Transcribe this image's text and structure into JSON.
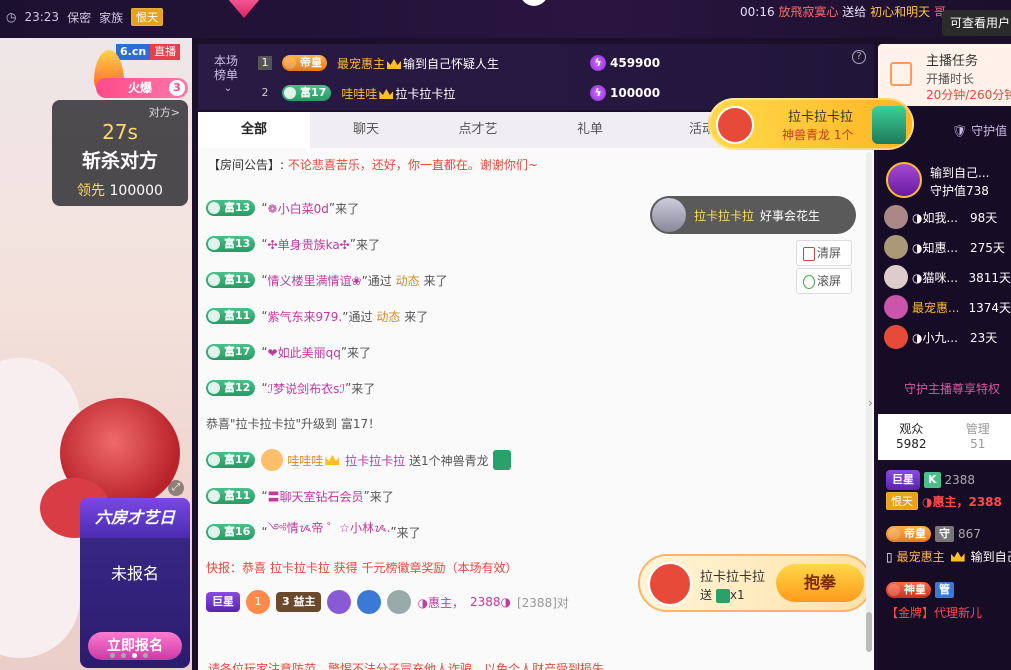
{
  "topbar": {
    "time": "23:23",
    "secret": "保密",
    "family": "家族",
    "family_badge": "恨天",
    "timer": "00:16",
    "ticker_a": "放飛寂寞心",
    "ticker_b": "送给",
    "ticker_c": "初心和明天",
    "ticker_d": "哥",
    "tooltip": "可查看用户"
  },
  "video": {
    "site_tag": "6.cn",
    "live_tag": "直播",
    "fire_label": "火爆",
    "fire_level": "3",
    "pk": {
      "link": "对方>",
      "timer": "27s",
      "title": "斩杀对方",
      "lead_label": "领先",
      "lead_value": "100000"
    },
    "sixroom": {
      "title": "六房才艺日",
      "status": "未报名",
      "button": "立即报名"
    }
  },
  "rank": {
    "label": "本场榜单",
    "rows": [
      {
        "no": "1",
        "level": "帝皇",
        "name": "最宠惠主",
        "target": "输到自己怀疑人生",
        "value": "459900"
      },
      {
        "no": "2",
        "level": "富17",
        "name": "哇哇哇",
        "target": "拉卡拉卡拉",
        "value": "100000"
      }
    ]
  },
  "chat": {
    "tabs": [
      "全部",
      "聊天",
      "点才艺",
      "礼单",
      "活动"
    ],
    "notice_key": "【房间公告】:",
    "notice_val": "不论悲喜苦乐，还好，你一直都在。谢谢你们~",
    "tools": {
      "clear": "清屏",
      "lock": "滚屏"
    },
    "pill": {
      "name": "拉卡拉卡拉",
      "text": "好事会花生"
    },
    "gift_popup": {
      "line1": "拉卡拉卡拉",
      "line2": "神兽青龙 1个"
    },
    "bow": {
      "name": "拉卡拉卡拉",
      "sub": "送",
      "count": "x1",
      "button": "抱拳"
    },
    "messages": [
      {
        "level": "富13",
        "name": "❁小白菜0d",
        "via": "",
        "suffix": "来了"
      },
      {
        "level": "富13",
        "name": "✣单身贵族ka✣",
        "via": "",
        "suffix": "来了"
      },
      {
        "level": "富11",
        "name": "情义楼里满情谊❀",
        "via": "动态",
        "suffix": "来了"
      },
      {
        "level": "富11",
        "name": "紫气东来979.",
        "via": "动态",
        "suffix": "来了"
      },
      {
        "level": "富17",
        "name": "❤如此美丽qq",
        "via": "",
        "suffix": "来了"
      },
      {
        "level": "富12",
        "name": "ℐ梦说剑布衣sℐ",
        "via": "",
        "suffix": "来了"
      }
    ],
    "upgrade": "恭喜\"拉卡拉卡拉\"升级到 富17！",
    "gift_msg": {
      "level": "富17",
      "from": "哇哇哇",
      "to": "拉卡拉卡拉",
      "text": "送1个神兽青龙"
    },
    "messages2": [
      {
        "level": "富11",
        "name": "〓聊天室钻石会员",
        "suffix": "来了"
      },
      {
        "level": "富16",
        "name": "༺情ᝰ帝 ゜☆小林ᝰ.",
        "suffix": "来了"
      }
    ],
    "news": "快报：恭喜 拉卡拉卡拉 获得 千元榜徽章奖励（本场有效）",
    "medal_row": {
      "chip1": "巨星",
      "chip2": "1",
      "chip3": "3 益主",
      "name": "◑惠主，",
      "score": "2388◑",
      "bracket": "[2388]对"
    },
    "warning": "请各位玩家注意防范，警惕不法分子冒充他人诈骗，以免个人财产受到损失"
  },
  "right": {
    "task": {
      "title": "主播任务",
      "sub": "开播时长",
      "progress": "20分钟/260分钟"
    },
    "guard_label": "守护值",
    "guard_top": {
      "name": "输到自己...",
      "value": "守护值738"
    },
    "guards": [
      {
        "name": "◑如我...",
        "days": "98天"
      },
      {
        "name": "◑知惠...",
        "days": "275天"
      },
      {
        "name": "◑猫咪...",
        "days": "3811天"
      },
      {
        "name": "最宠惠...",
        "days": "1374天"
      },
      {
        "name": "◑小九...",
        "days": "23天"
      }
    ],
    "privilege": "守护主播尊享特权",
    "audience": {
      "label": "观众",
      "count": "5982",
      "manage_label": "管理",
      "manage_count": "51"
    },
    "audience_list": [
      {
        "chip": "巨星",
        "k": "K",
        "score": "2388",
        "tag": "恨天",
        "name": "◑惠主，2388"
      },
      {
        "chip": "帝皇",
        "k": "守",
        "score": "867",
        "tag": "",
        "name": "最宠惠主",
        "extra": "输到自己"
      },
      {
        "chip": "神皇",
        "k": "管",
        "score": "",
        "tag": "【金牌】代理新儿",
        "name": ""
      }
    ]
  }
}
